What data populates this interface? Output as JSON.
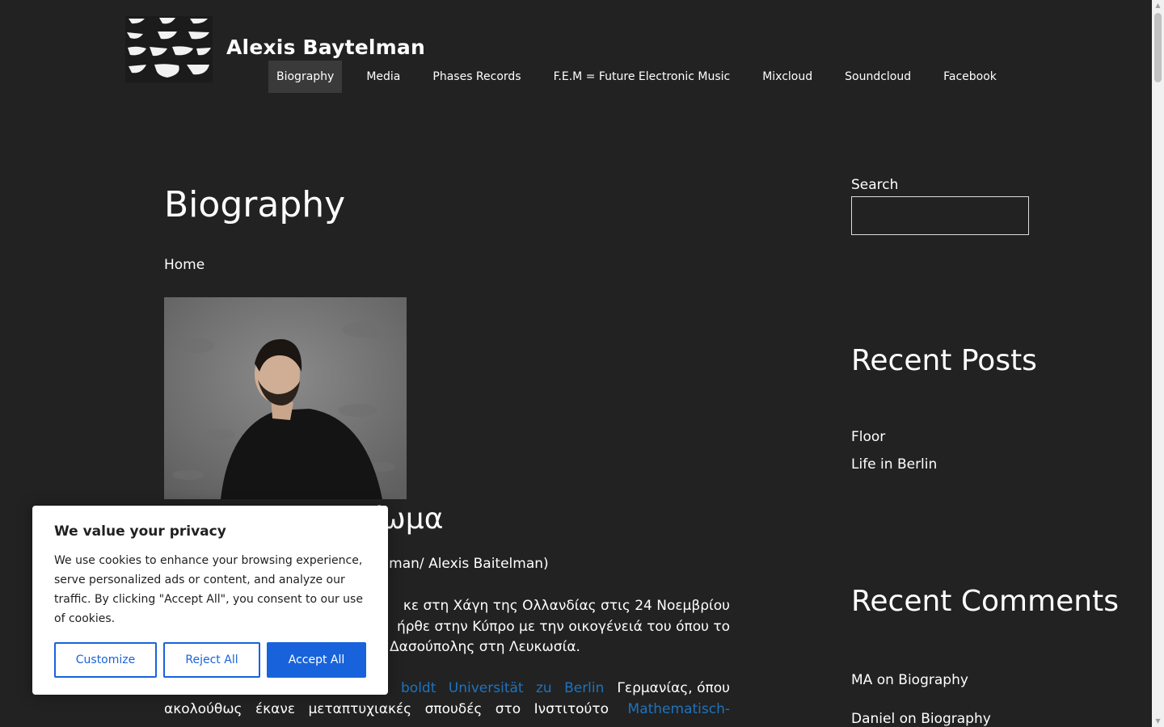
{
  "header": {
    "site_title": "Alexis Baytelman",
    "logo_icon": "abstract-shapes-logo",
    "nav": [
      "Biography",
      "Media",
      "Phases Records",
      "F.E.M = Future Electronic Music",
      "Mixcloud",
      "Soundcloud",
      "Facebook"
    ],
    "active_nav": "Biography"
  },
  "main": {
    "page_title": "Biography",
    "breadcrumb": "Home",
    "bio_heading_visible": "είωμα",
    "subname_visible": "elman/ Alexis Baitelman)",
    "para1": [
      "κε στη Χάγη της Ολλανδίας στις 24 Νοεμβρίου",
      "ήρθε στην Κύπρο με την οικογένειά του όπου το",
      "Δασούπολης στη Λευκωσία."
    ],
    "para2_line1_link": "boldt Universität zu Berlin",
    "para2_line1_text": "Γερμανίας, όπου",
    "para2_line2_text": "ακολούθως έκανε μεταπτυχιακές σπουδές στο Ινστιτούτο",
    "para2_line2_link": "Mathematisch-"
  },
  "sidebar": {
    "search_label": "Search",
    "search_value": "",
    "recent_posts_title": "Recent Posts",
    "recent_posts": [
      "Floor",
      "Life in Berlin"
    ],
    "recent_comments_title": "Recent Comments",
    "recent_comments": [
      {
        "author": "MA",
        "on": "on",
        "post": "Biography"
      },
      {
        "author": "Daniel",
        "on": "on",
        "post": "Biography"
      }
    ]
  },
  "cookie_banner": {
    "title": "We value your privacy",
    "text": "We use cookies to enhance your browsing experience, serve personalized ads or content, and analyze our traffic. By clicking \"Accept All\", you consent to our use of cookies.",
    "customize": "Customize",
    "reject": "Reject All",
    "accept": "Accept All"
  },
  "colors": {
    "background": "#222222",
    "link": "#1e73be",
    "cookie_accent": "#1863dc"
  }
}
